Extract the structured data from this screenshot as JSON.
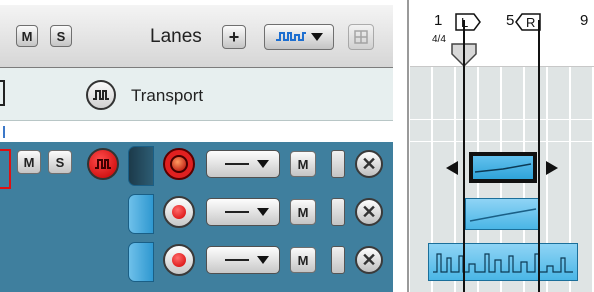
{
  "header": {
    "mute_label": "M",
    "solo_label": "S",
    "lanes_label": "Lanes",
    "lanes_add_label": "+"
  },
  "transport": {
    "label": "Transport"
  },
  "tracks": [
    {
      "mute_label": "M",
      "solo_label": "S",
      "rec_armed": true,
      "lane_mute_label": "M",
      "delete_label": "✕"
    },
    {
      "lane_mute_label": "M",
      "rec_armed": false,
      "delete_label": "✕"
    },
    {
      "lane_mute_label": "M",
      "rec_armed": false,
      "delete_label": "✕"
    }
  ],
  "ruler": {
    "bars": [
      "1",
      "5",
      "9"
    ],
    "time_signature": "4/4",
    "left_locator": "L",
    "right_locator": "R"
  },
  "colors": {
    "track_bg": "#3f7f9e",
    "clip_blue": "#4ab6e6",
    "record_red": "#e02020",
    "transport_bg": "#e7efef"
  }
}
